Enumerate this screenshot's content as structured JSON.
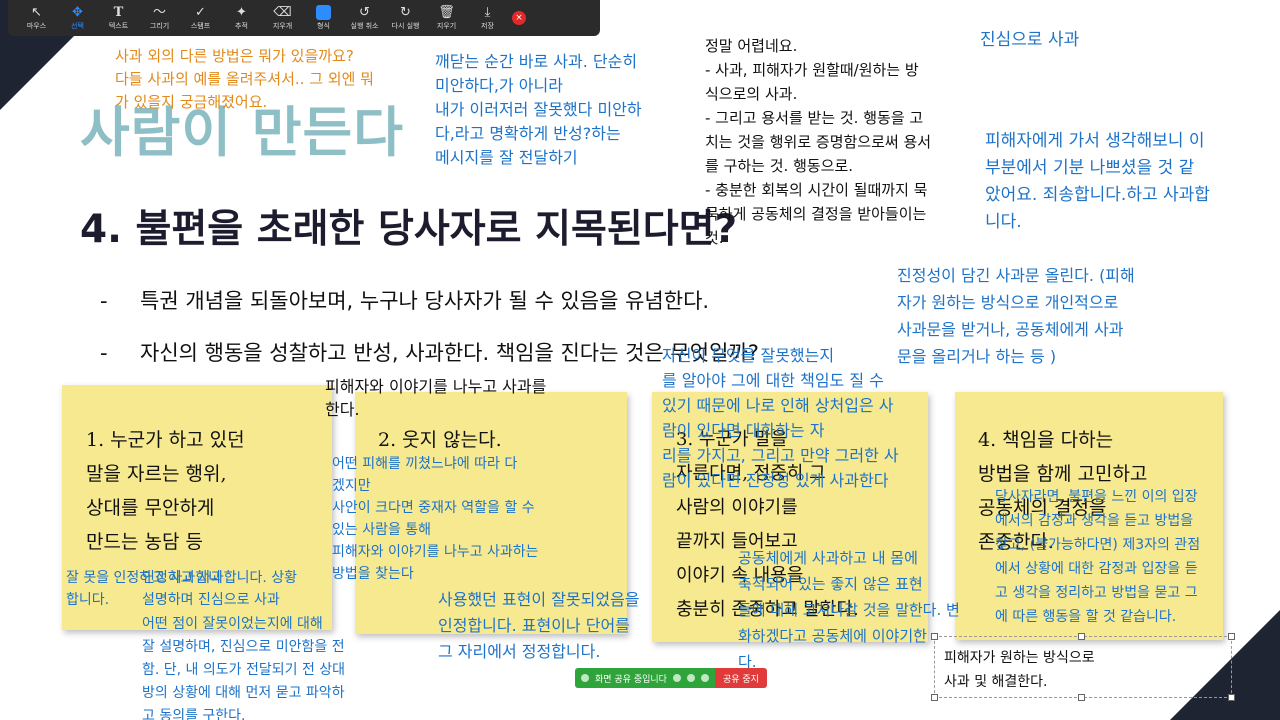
{
  "toolbar": {
    "tools": [
      {
        "label": "마우스",
        "icon": "↖"
      },
      {
        "label": "선택",
        "icon": "✥"
      },
      {
        "label": "텍스트",
        "icon": "T"
      },
      {
        "label": "그리기",
        "icon": "〜"
      },
      {
        "label": "스탬프",
        "icon": "✓"
      },
      {
        "label": "추적",
        "icon": "✦"
      },
      {
        "label": "지우개",
        "icon": "⌫"
      },
      {
        "label": "형식",
        "icon": ""
      },
      {
        "label": "실행 취소",
        "icon": "↺"
      },
      {
        "label": "다시 실행",
        "icon": "↻"
      },
      {
        "label": "지우기",
        "icon": "🗑"
      },
      {
        "label": "저장",
        "icon": "⤓"
      }
    ],
    "active_color": "#2d8cff",
    "close_icon": "×"
  },
  "slide": {
    "title": "사람이 만든다",
    "heading": "4. 불편을 초래한 당사자로 지목된다면?",
    "bullet_mark": "-",
    "bullets": [
      "특권 개념을 되돌아보며, 누구나 당사자가 될 수 있음을 유념한다.",
      "자신의 행동을 성찰하고 반성, 사과한다. 책임을 진다는 것은 무엇일까?"
    ]
  },
  "stickies": [
    "1. 누군가 하고 있던\n말을 자르는 행위,\n상대를 무안하게\n만드는 농담 등",
    "2. 웃지 않는다.",
    "3. 누군가 말을\n자른다면, 정중히 그\n사람의 이야기를\n끝까지 들어보고\n이야기 속 내용을\n충분히 존중하고 말한다.",
    "4. 책임을 다하는\n방법을 함께 고민하고\n공동체의 결정을\n존중한다."
  ],
  "annotations": {
    "orange_question": "사과 외의 다른 방법은 뭐가 있을까요?\n다들 사과의 예를 올려주셔서.. 그 외엔 뭐\n가 있을지 궁금해졌어요.",
    "realize": "깨닫는 순간 바로 사과. 단순히\n미안하다,가 아니라\n내가 이러저러 잘못했다 미안하\n다,라고 명확하게 반성?하는\n메시지를 잘 전달하기",
    "hard": "정말 어렵네요.\n- 사과, 피해자가 원할때/원하는 방\n식으로의 사과.\n- 그리고 용서를 받는 것. 행동을 고\n치는 것을 행위로 증명함으로써 용서\n를 구하는 것. 행동으로.\n- 충분한 회복의 시간이 될때까지 묵\n묵하게 공동체의 결정을 받아들이는\n것.",
    "sincere": "진심으로 사과",
    "victim_think": "피해자에게 가서 생각해보니 이\n부분에서 기분 나쁘셨을 것 같\n았어요. 죄송합니다.하고 사과합\n니다.",
    "genuine": "진정성이 담긴 사과문 올린다. (피해\n자가 원하는 방식으로 개인적으로\n사과문을 받거나, 공동체에게 사과\n문을 올리거나 하는 등 )",
    "know_wrong": "자신이 무엇을 잘못했는지\n를 알아야 그에 대한 책임도 질 수\n있기 때문에 나로 인해 상처입은 사\n람이 있다면 대화하는 자\n리를 가지고, 그리고 만약 그러한 사\n람이 있다면 진정성 있게 사과한다",
    "talk_victim": "피해자와 이야기를 나누고 사과를\n한다.",
    "mediator": "어떤 피해를 끼쳤느냐에 따라 다\n겠지만\n사안이 크다면 중재자 역할을 할 수\n있는 사람을 통해\n피해자와 이야기를 나누고 사과하는\n방법을 찾는다",
    "left_wrong": "잘 못을 인정하고 사과합니\n합니다.",
    "left_mix": "인정하고 사과합니다. 상황\n설명하며 진심으로 사과",
    "explain": "어떤 점이 잘못이었는지에 대해\n잘 설명하며, 진심으로 미안함을 전\n함. 단, 내 의도가 전달되기 전 상대\n방의 상황에 대해 먼저 묻고 파악하\n고 동의를 구한다.",
    "expression": "사용했던 표현이 잘못되었음을\n인정합니다. 표현이나 단어를\n그 자리에서 정정합니다.",
    "community": "공동체에게 사과하고 내 몸에\n축적되어 있는 좋지 않은 표현\n들에 대해 고쳐나갈 것을 말한다. 변\n화하겠다고 공동체에 이야기한\n다.",
    "third_party": "당사자라면, 불편을 느낀 이의 입장\n에서의 감정과 생각을 듣고 방법을\n찾고, (불가능하다면) 제3자의 관점\n에서 상황에 대한 감정과 입장을 듣\n고 생각을 정리하고 방법을 묻고 그\n에 따른 행동을 할 것 같습니다.",
    "victim_way": "피해자가 원하는 방식으로\n사과 및 해결한다."
  },
  "share_bar": {
    "status": "화면 공유 중입니다",
    "stop": "공유 중지"
  },
  "colors": {
    "annotation_blue": "#1e73c8",
    "annotation_orange": "#e28a1c",
    "title_teal": "#8fbfc6",
    "sticky_yellow": "#f7e98f",
    "share_green": "#2ea43a",
    "share_red": "#e13a3a"
  }
}
